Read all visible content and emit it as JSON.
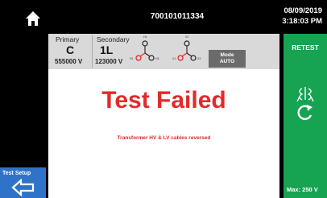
{
  "header": {
    "serial": "700101011334",
    "date": "08/09/2019",
    "time": "3:18:03 PM"
  },
  "config": {
    "primary_label": "Primary",
    "primary_value": "C",
    "primary_voltage": "555000 V",
    "secondary_label": "Secondary",
    "secondary_value": "1L",
    "secondary_voltage": "123000 V",
    "mode_label": "Mode",
    "mode_value": "AUTO",
    "diagram_labels": [
      "H2",
      "H1",
      "H3",
      "X2",
      "X1",
      "X3"
    ]
  },
  "result": {
    "status": "Test Failed",
    "reason": "Transformer HV & LV cables reversed"
  },
  "actions": {
    "retest_label": "RETEST",
    "test_setup_label": "Test Setup",
    "max_voltage": "Max: 250 V"
  },
  "icons": {
    "home": "home-icon",
    "back": "arrow-left-icon",
    "retest": "retest-icon"
  },
  "colors": {
    "fail_red": "#e22a2a",
    "retest_green": "#16a352",
    "setup_blue": "#2f73c9"
  }
}
